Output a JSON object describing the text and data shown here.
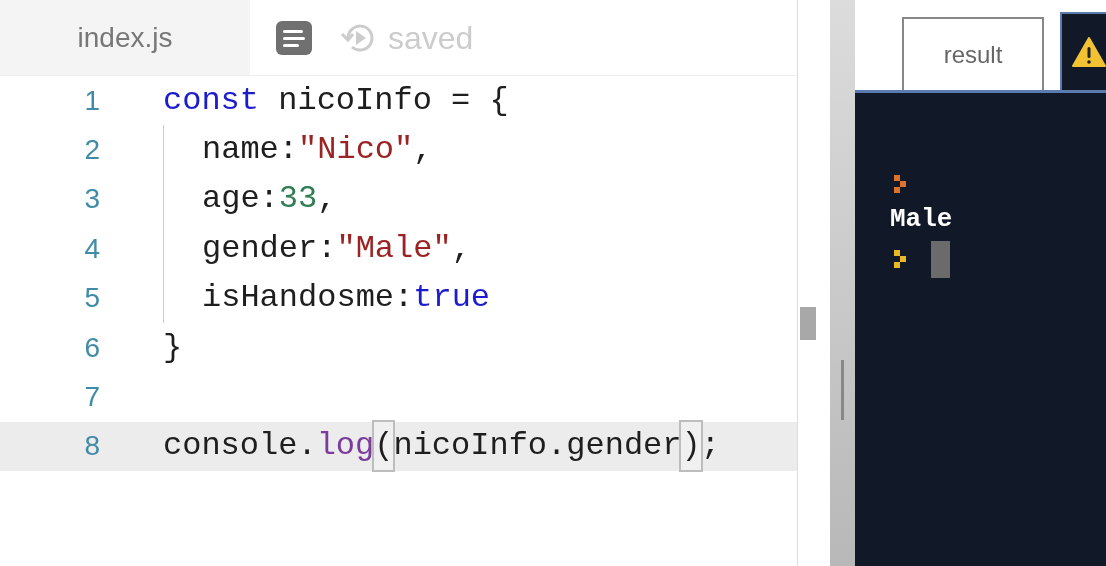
{
  "editor": {
    "file_tab": {
      "label": "index.js",
      "selected": true
    },
    "status": "saved",
    "lines": [
      {
        "number": "1",
        "selected": false,
        "indented": false,
        "tokens": [
          {
            "kind": "keyword",
            "text": "const"
          },
          {
            "kind": "plain",
            "text": " nicoInfo = {"
          }
        ]
      },
      {
        "number": "2",
        "selected": false,
        "indented": true,
        "tokens": [
          {
            "kind": "plain",
            "text": "name:"
          },
          {
            "kind": "string",
            "text": "\"Nico\""
          },
          {
            "kind": "plain",
            "text": ","
          }
        ]
      },
      {
        "number": "3",
        "selected": false,
        "indented": true,
        "tokens": [
          {
            "kind": "plain",
            "text": "age:"
          },
          {
            "kind": "number",
            "text": "33"
          },
          {
            "kind": "plain",
            "text": ","
          }
        ]
      },
      {
        "number": "4",
        "selected": false,
        "indented": true,
        "tokens": [
          {
            "kind": "plain",
            "text": "gender:"
          },
          {
            "kind": "string",
            "text": "\"Male\""
          },
          {
            "kind": "plain",
            "text": ","
          }
        ]
      },
      {
        "number": "5",
        "selected": false,
        "indented": true,
        "tokens": [
          {
            "kind": "plain",
            "text": "isHandosme:"
          },
          {
            "kind": "keyword",
            "text": "true"
          }
        ]
      },
      {
        "number": "6",
        "selected": false,
        "indented": false,
        "tokens": [
          {
            "kind": "plain",
            "text": "}"
          }
        ]
      },
      {
        "number": "7",
        "selected": false,
        "indented": false
      },
      {
        "number": "8",
        "selected": true,
        "indented": false,
        "tokens": [
          {
            "kind": "plain",
            "text": "console."
          },
          {
            "kind": "method",
            "text": "log"
          },
          {
            "kind": "match",
            "text": "("
          },
          {
            "kind": "plain",
            "text": "nicoInfo.gender"
          },
          {
            "kind": "match",
            "text": ")"
          },
          {
            "kind": "plain",
            "text": ";"
          }
        ]
      }
    ]
  },
  "result": {
    "tabs": [
      {
        "kind": "text",
        "label": "result",
        "selected": false
      },
      {
        "kind": "warning",
        "selected": true
      }
    ],
    "console": [
      {
        "kind": "prompt",
        "color": "#e0702a"
      },
      {
        "kind": "output",
        "text": "Male"
      },
      {
        "kind": "input",
        "color": "#e8b923"
      }
    ]
  }
}
